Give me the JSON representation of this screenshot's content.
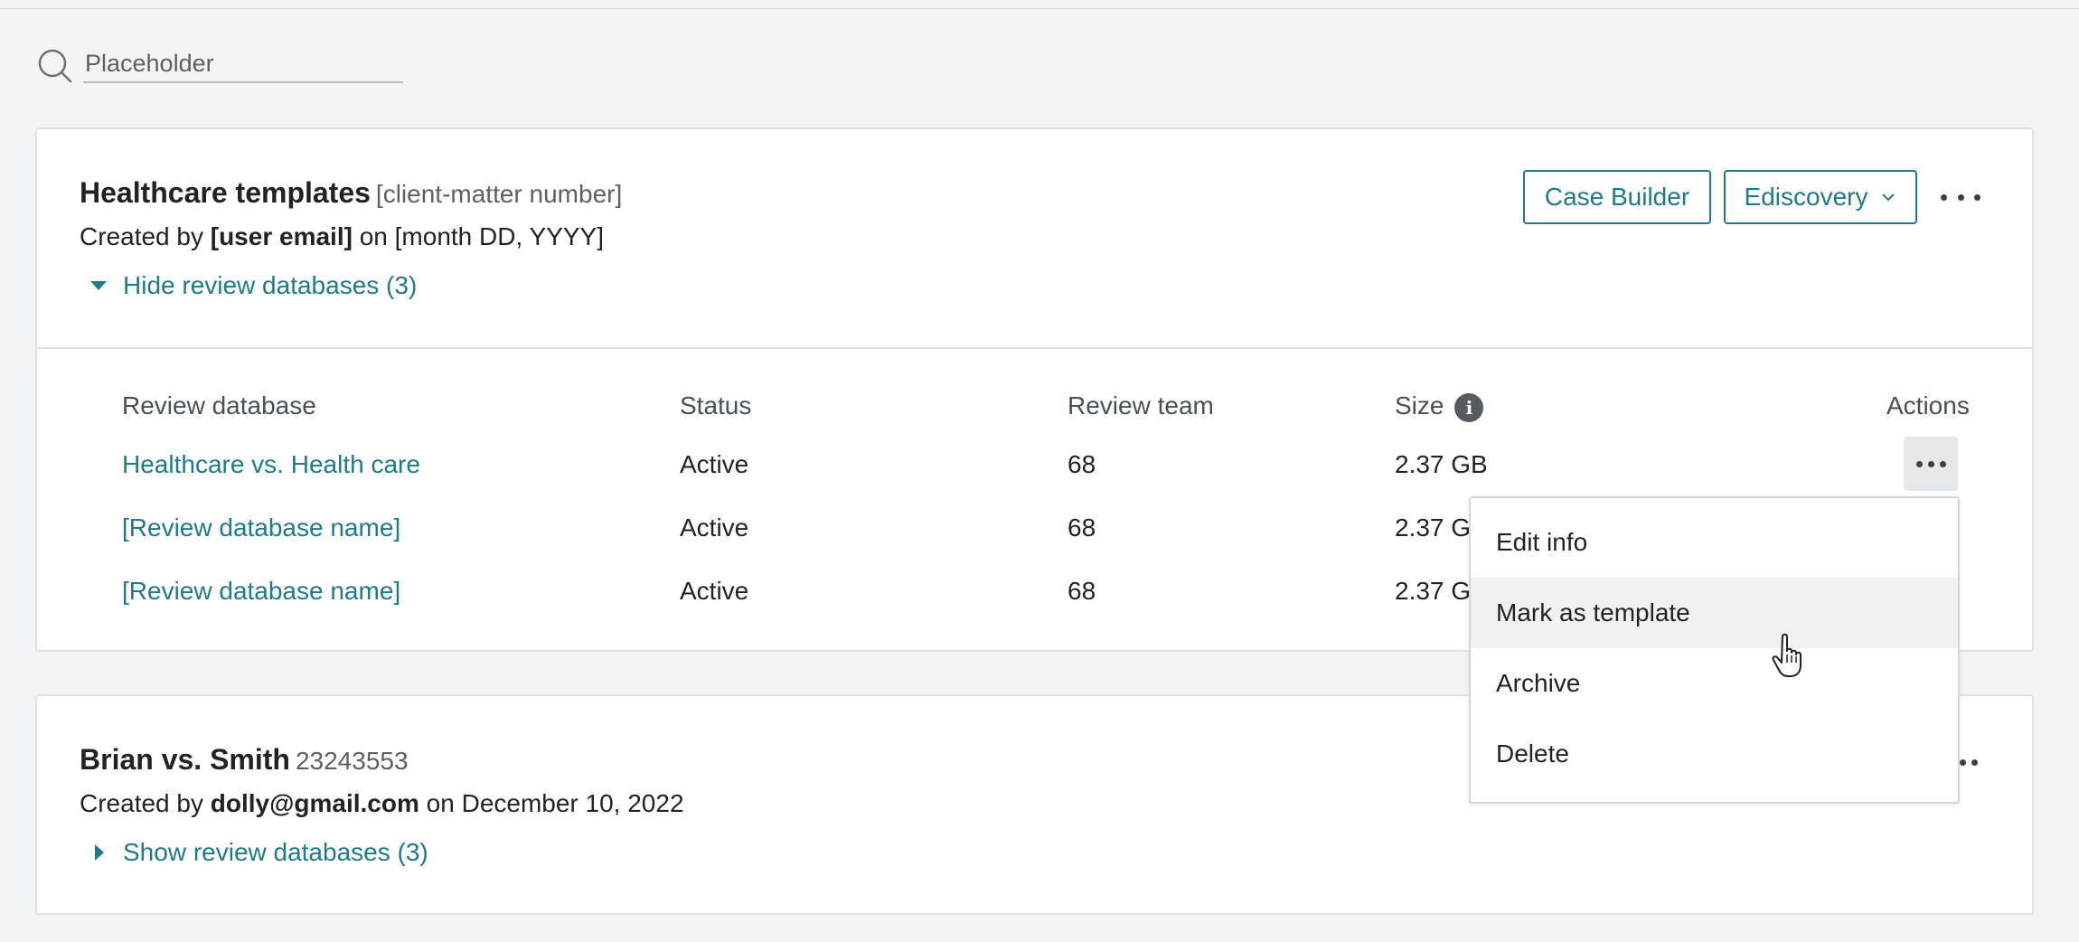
{
  "search": {
    "placeholder": "Placeholder"
  },
  "cards": [
    {
      "title": "Healthcare templates",
      "meta": "[client-matter number]",
      "created_prefix": "Created by",
      "created_by": "[user email]",
      "created_on_prefix": "on",
      "created_date": "[month DD, YYYY]",
      "toggle_label": "Hide review databases (3)",
      "buttons": {
        "case_builder": "Case Builder",
        "ediscovery": "Ediscovery"
      },
      "table": {
        "headers": {
          "review_database": "Review database",
          "status": "Status",
          "review_team": "Review team",
          "size": "Size",
          "actions": "Actions"
        },
        "rows": [
          {
            "name": "Healthcare vs. Health care",
            "status": "Active",
            "team": "68",
            "size": "2.37 GB"
          },
          {
            "name": "[Review database name]",
            "status": "Active",
            "team": "68",
            "size": "2.37 GB"
          },
          {
            "name": "[Review database name]",
            "status": "Active",
            "team": "68",
            "size": "2.37 GB"
          }
        ]
      }
    },
    {
      "title": "Brian vs. Smith",
      "meta": "23243553",
      "created_prefix": "Created by",
      "created_by": "dolly@gmail.com",
      "created_on_prefix": "on",
      "created_date": "December 10, 2022",
      "toggle_label": "Show review databases (3)"
    }
  ],
  "menu": {
    "items": [
      "Edit info",
      "Mark as template",
      "Archive",
      "Delete"
    ],
    "hovered": "Mark as template"
  },
  "colors": {
    "accent": "#1f7a8c",
    "background": "#f3f4f5",
    "text": "#1f2326"
  }
}
